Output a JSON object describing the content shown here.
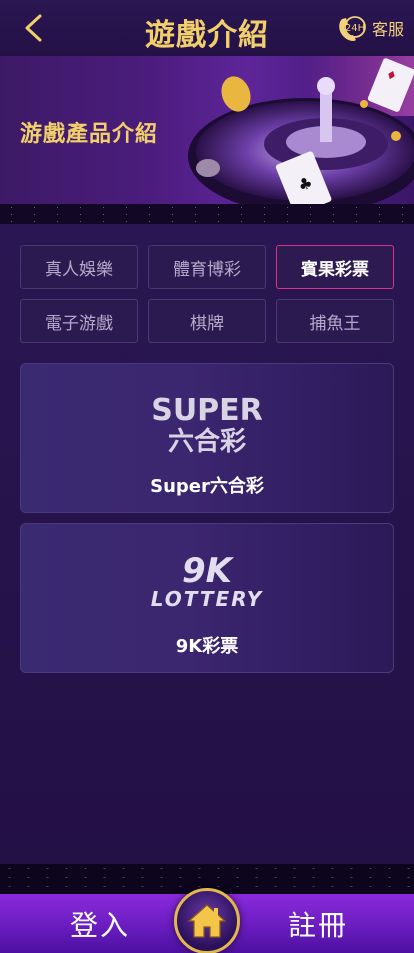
{
  "header": {
    "title": "遊戲介紹",
    "support_label": "客服",
    "support_badge": "24H"
  },
  "banner": {
    "title": "游戲產品介紹"
  },
  "tabs": [
    {
      "label": "真人娛樂",
      "active": false
    },
    {
      "label": "體育博彩",
      "active": false
    },
    {
      "label": "賓果彩票",
      "active": true
    },
    {
      "label": "電子游戲",
      "active": false
    },
    {
      "label": "棋牌",
      "active": false
    },
    {
      "label": "捕魚王",
      "active": false
    }
  ],
  "games": [
    {
      "name": "Super六合彩",
      "logo_top": "SUPER",
      "logo_bottom": "六合彩"
    },
    {
      "name": "9K彩票",
      "logo_top": "9K",
      "logo_bottom": "LOTTERY"
    }
  ],
  "bottom_bar": {
    "login_label": "登入",
    "register_label": "註冊"
  },
  "colors": {
    "accent_gold": "#f1cf6a",
    "active_border": "#d9338a",
    "bottom_bar": "#6a1cc0"
  }
}
